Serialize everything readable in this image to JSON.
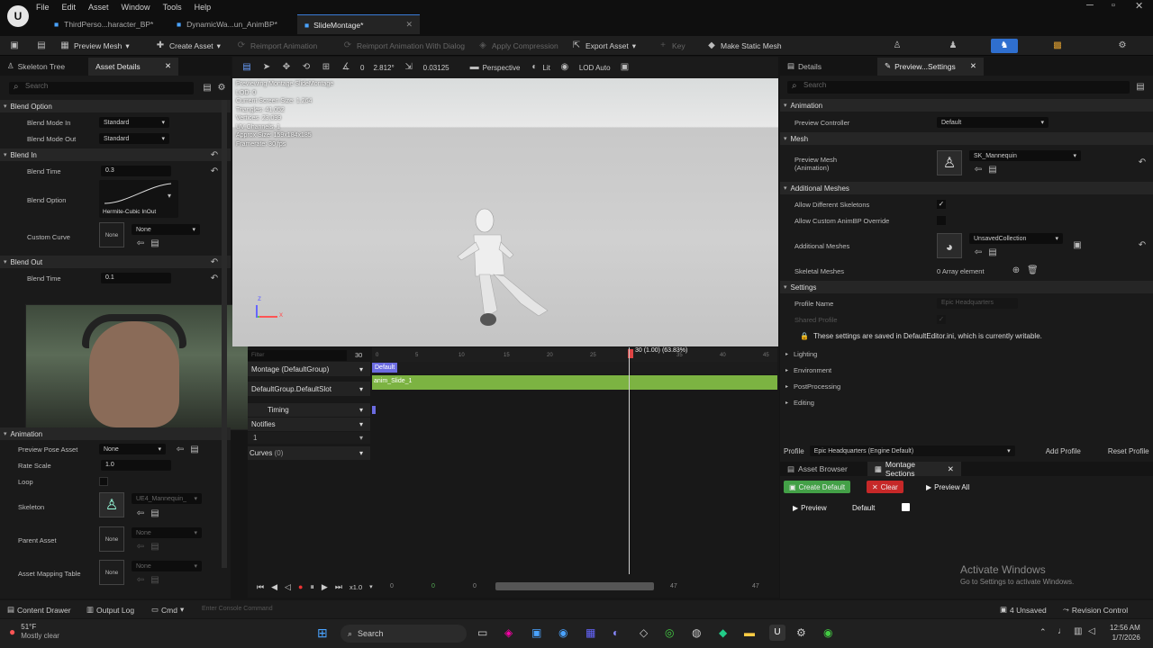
{
  "menu": [
    "File",
    "Edit",
    "Asset",
    "Window",
    "Tools",
    "Help"
  ],
  "tabs": [
    {
      "label": "ThirdPerso...haracter_BP*",
      "active": false
    },
    {
      "label": "DynamicWa...un_AnimBP*",
      "active": false
    },
    {
      "label": "SlideMontage*",
      "active": true
    }
  ],
  "toolbar": {
    "preview_mesh": "Preview Mesh",
    "create_asset": "Create Asset",
    "reimport": "Reimport Animation",
    "reimport_dialog": "Reimport Animation With Dialog",
    "apply_compression": "Apply Compression",
    "export_asset": "Export Asset",
    "key": "Key",
    "make_static_mesh": "Make Static Mesh"
  },
  "left_panel": {
    "tab_skeleton_tree": "Skeleton Tree",
    "tab_asset_details": "Asset Details",
    "search_placeholder": "Search",
    "sections": {
      "blend_option": "Blend Option",
      "blend_in": "Blend In",
      "blend_out": "Blend Out",
      "animation": "Animation"
    },
    "props": {
      "blend_mode_in": "Blend Mode In",
      "blend_mode_in_value": "Standard",
      "blend_mode_out": "Blend Mode Out",
      "blend_mode_out_value": "Standard",
      "blend_time": "Blend Time",
      "blend_in_time": "0.3",
      "blend_option": "Blend Option",
      "blend_option_value": "Hermite-Cubic InOut",
      "custom_curve": "Custom Curve",
      "none": "None",
      "blend_out_time": "0.1",
      "preview_pose_asset": "Preview Pose Asset",
      "rate_scale": "Rate Scale",
      "rate_scale_value": "1.0",
      "loop": "Loop",
      "skeleton": "Skeleton",
      "skeleton_value": "UE4_Mannequin_",
      "parent_asset": "Parent Asset",
      "asset_mapping_table": "Asset Mapping Table"
    }
  },
  "viewport": {
    "lod": "0",
    "fov": "2.812°",
    "scale": "0.03125",
    "perspective": "Perspective",
    "lit": "Lit",
    "lod_auto": "LOD Auto",
    "info": [
      "Previewing Montage SlideMontage",
      "LOD: 0",
      "Current Screen Size: 1.264",
      "Triangles: 41,052",
      "Vertices: 23,099",
      "UV Channels: 1",
      "Approx Size: 159x184x185",
      "Framerate: 30 fps"
    ]
  },
  "timeline": {
    "filter_placeholder": "Filter",
    "frame": "30",
    "scrub_label": "30 (1.00) (63.83%)",
    "ticks": [
      "0",
      "5",
      "10",
      "15",
      "20",
      "25",
      "35",
      "40",
      "45"
    ],
    "montage_group": "Montage (DefaultGroup)",
    "default_tag": "Default",
    "slot": "DefaultGroup.DefaultSlot",
    "clip": "anim_Slide_1",
    "timing": "Timing",
    "notifies": "Notifies",
    "notify_track": "1",
    "curves": "Curves",
    "curves_count": "(0)",
    "playback_rate": "x1.0",
    "range_start": "0",
    "range_green": "0",
    "range_a": "0",
    "range_end": "47",
    "range_end2": "47"
  },
  "right_panel": {
    "tab_details": "Details",
    "tab_preview_settings": "Preview...Settings",
    "search_placeholder": "Search",
    "animation_section": "Animation",
    "preview_controller": "Preview Controller",
    "preview_controller_value": "Default",
    "mesh_section": "Mesh",
    "preview_mesh": "Preview Mesh (Animation)",
    "preview_mesh_value": "SK_Mannequin",
    "additional_meshes_section": "Additional Meshes",
    "allow_different_skeletons": "Allow Different Skeletons",
    "allow_custom_animbp": "Allow Custom AnimBP Override",
    "additional_meshes": "Additional Meshes",
    "additional_meshes_value": "UnsavedCollection",
    "skeletal_meshes": "Skeletal Meshes",
    "skeletal_meshes_value": "0 Array element",
    "settings_section": "Settings",
    "profile_name": "Profile Name",
    "profile_name_value": "Epic Headquarters",
    "shared_profile": "Shared Profile",
    "saved_note": "These settings are saved in DefaultEditor.ini, which is currently writable.",
    "lighting": "Lighting",
    "environment": "Environment",
    "postprocessing": "PostProcessing",
    "editing": "Editing",
    "profile_label": "Profile",
    "profile_value": "Epic Headquarters (Engine Default)",
    "add_profile": "Add Profile",
    "reset_profile": "Reset Profile"
  },
  "montage_sections": {
    "tab_asset_browser": "Asset Browser",
    "tab_montage_sections": "Montage Sections",
    "create_default": "Create Default",
    "clear": "Clear",
    "preview_all": "Preview All",
    "preview": "Preview",
    "default": "Default"
  },
  "watermark": {
    "title": "Activate Windows",
    "subtitle": "Go to Settings to activate Windows."
  },
  "statusbar": {
    "content_drawer": "Content Drawer",
    "output_log": "Output Log",
    "cmd": "Cmd",
    "console_placeholder": "Enter Console Command",
    "unsaved": "4 Unsaved",
    "revision_control": "Revision Control"
  },
  "taskbar": {
    "weather_temp": "51°F",
    "weather_desc": "Mostly clear",
    "search": "Search",
    "time": "12:56 AM",
    "date": "1/7/2026"
  },
  "colors": {
    "accent_blue": "#3a7bd5",
    "clip_green": "#7cb342",
    "create_default_green": "#43a047",
    "clear_red": "#c62828"
  }
}
